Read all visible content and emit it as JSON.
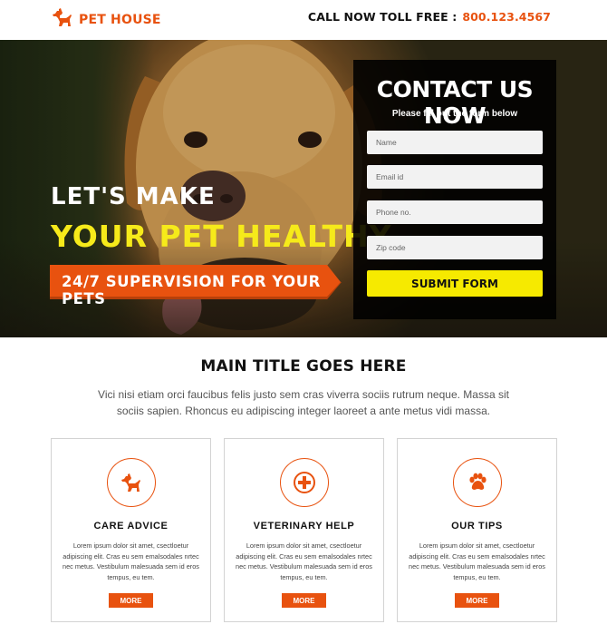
{
  "header": {
    "brand": "PET HOUSE",
    "call_label": "CALL NOW TOLL FREE :",
    "phone": "800.123.4567"
  },
  "hero": {
    "line1": "LET'S MAKE",
    "line2": "YOUR PET HEALTHY",
    "banner": "24/7 SUPERVISION FOR YOUR PETS"
  },
  "form": {
    "title": "CONTACT US NOW",
    "subtitle": "Please fill out the form below",
    "fields": {
      "name": "Name",
      "email": "Email id",
      "phone": "Phone no.",
      "zip": "Zip code"
    },
    "submit": "SUBMIT FORM"
  },
  "main": {
    "title": "MAIN TITLE GOES HERE",
    "description": "Vici nisi etiam orci faucibus felis justo sem cras viverra sociis rutrum neque. Massa sit sociis sapien. Rhoncus eu adipiscing integer laoreet a ante metus vidi massa."
  },
  "cards": [
    {
      "icon": "dog-icon",
      "title": "CARE ADVICE",
      "text": "Lorem ipsum dolor sit amet, csectloetur adipiscing elit. Cras eu sem emalsodales nrtec nec metus. Vestibulum malesuada sem id eros tempus, eu tem.",
      "button": "MORE"
    },
    {
      "icon": "medical-cross-icon",
      "title": "VETERINARY HELP",
      "text": "Lorem ipsum dolor sit amet, csectloetur adipiscing elit. Cras eu sem emalsodales nrtec nec metus. Vestibulum malesuada sem id eros tempus, eu tem.",
      "button": "MORE"
    },
    {
      "icon": "paw-icon",
      "title": "OUR TIPS",
      "text": "Lorem ipsum dolor sit amet, csectloetur adipiscing elit. Cras eu sem emalsodales nrtec nec metus. Vestibulum malesuada sem id eros tempus, eu tem.",
      "button": "MORE"
    }
  ],
  "colors": {
    "accent": "#e8520f",
    "highlight": "#f6ea1a",
    "form_bg": "#000000"
  }
}
